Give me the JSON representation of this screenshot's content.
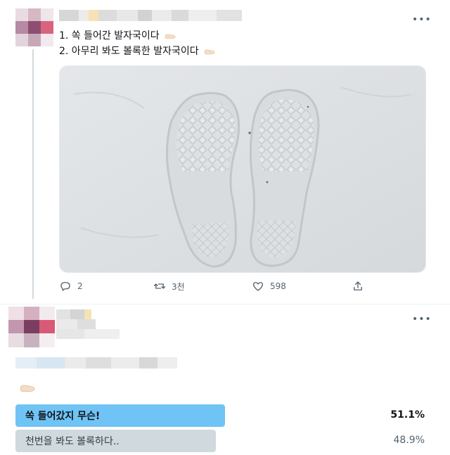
{
  "tweet": {
    "line1_text": "1. 쏙 들어간 발자국이다",
    "line2_text": "2. 아무리 봐도 볼록한 발자국이다",
    "line1_icon": "foot-emoji",
    "line2_icon": "foot-emoji",
    "photo_description_icon": "snow-footprints-photo",
    "more_icon": "more-options-icon",
    "actions": {
      "reply_count": "2",
      "retweet_count": "3천",
      "like_count": "598",
      "share_icon": "share-icon"
    }
  },
  "reply": {
    "more_icon": "more-options-icon",
    "emoji_icon": "foot-emoji",
    "poll": {
      "options": [
        {
          "label": "쏙 들어갔지 무슨!",
          "percent": "51.1%",
          "share": 0.511,
          "winner": true
        },
        {
          "label": "천번을 봐도 볼록하다..",
          "percent": "48.9%",
          "share": 0.489,
          "winner": false
        }
      ]
    }
  },
  "colors": {
    "winner_bar": "#70c4f5",
    "loser_bar": "#cfd9de",
    "action_icon": "#536471",
    "divider": "#eff3f4"
  }
}
